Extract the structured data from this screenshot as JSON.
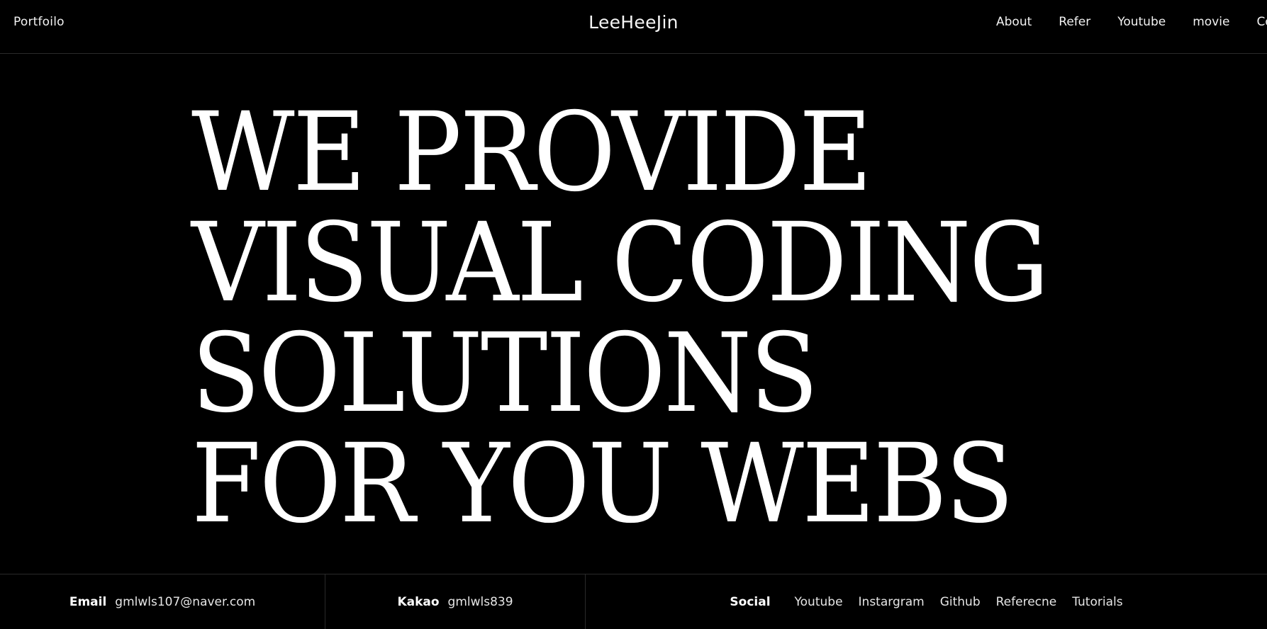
{
  "header": {
    "left_title": "Portfoilo",
    "brand": "LeeHeeJin",
    "nav": [
      "About",
      "Refer",
      "Youtube",
      "movie",
      "Contact"
    ]
  },
  "hero": {
    "lines": [
      "WE PROVIDE",
      "VISUAL CODING",
      "SOLUTIONS",
      "FOR YOU WEBS"
    ]
  },
  "footer": {
    "email_label": "Email",
    "email_value": "gmlwls107@naver.com",
    "kakao_label": "Kakao",
    "kakao_value": "gmlwls839",
    "social_label": "Social",
    "social_links": [
      "Youtube",
      "Instargram",
      "Github",
      "Referecne",
      "Tutorials"
    ]
  },
  "colors": {
    "background": "#000000",
    "text": "#ffffff",
    "divider": "#2a2a2a"
  }
}
